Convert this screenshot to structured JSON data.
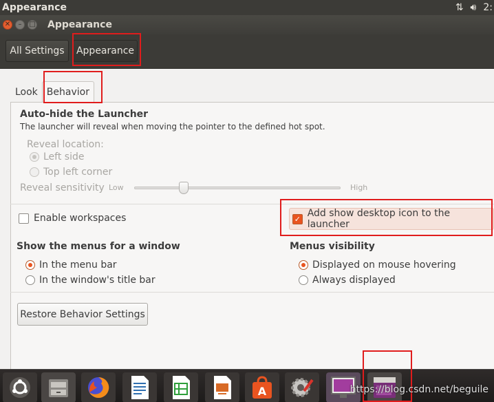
{
  "top_panel": {
    "app_title": "Appearance",
    "clock": "2:"
  },
  "window": {
    "title": "Appearance"
  },
  "toolbar": {
    "all_settings": "All Settings",
    "appearance": "Appearance"
  },
  "tabs": [
    {
      "label": "Look"
    },
    {
      "label": "Behavior"
    }
  ],
  "autohide": {
    "title": "Auto-hide the Launcher",
    "description": "The launcher will reveal when moving the pointer to the defined hot spot.",
    "reveal_location_label": "Reveal location:",
    "options": [
      "Left side",
      "Top left corner"
    ],
    "selected": "Left side",
    "sensitivity_label": "Reveal sensitivity",
    "low_label": "Low",
    "high_label": "High",
    "sensitivity_value": 0.25
  },
  "checks": {
    "workspaces": {
      "label": "Enable workspaces",
      "checked": false
    },
    "desktop_icon": {
      "label": "Add show desktop icon to the launcher",
      "checked": true
    }
  },
  "menus": {
    "title": "Show the menus for a window",
    "options": [
      "In the menu bar",
      "In the window's title bar"
    ],
    "selected": "In the menu bar"
  },
  "visibility": {
    "title": "Menus visibility",
    "options": [
      "Displayed on mouse hovering",
      "Always displayed"
    ],
    "selected": "Displayed on mouse hovering"
  },
  "restore_button": "Restore Behavior Settings",
  "dock_items": [
    "ubuntu-dash-icon",
    "files-icon",
    "firefox-icon",
    "writer-icon",
    "calc-icon",
    "impress-icon",
    "software-center-icon",
    "system-settings-icon",
    "appearance-icon",
    "show-desktop-icon"
  ],
  "watermark": "https://blog.csdn.net/beguile",
  "colors": {
    "accent": "#e95420",
    "highlight": "#e01c1c"
  }
}
